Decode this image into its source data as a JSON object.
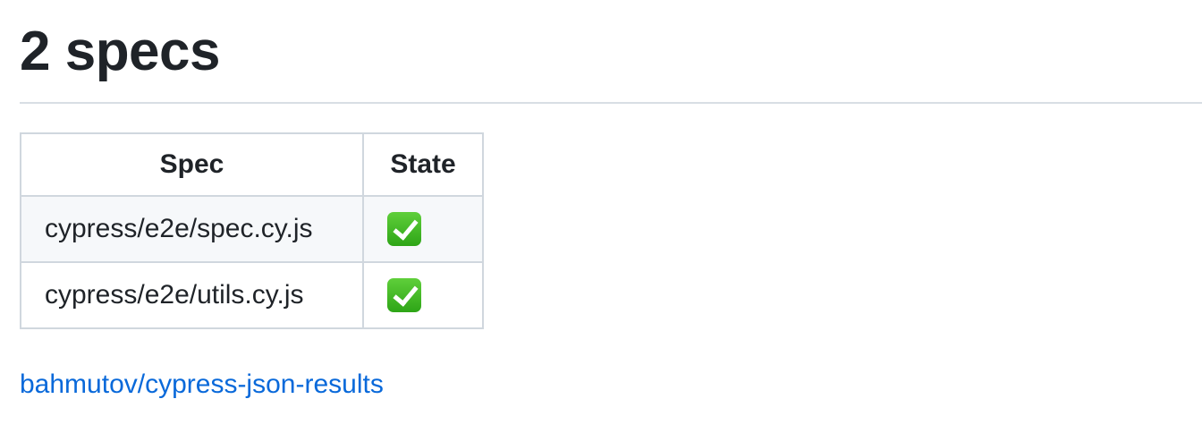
{
  "header": {
    "title": "2 specs"
  },
  "table": {
    "columns": [
      "Spec",
      "State"
    ],
    "rows": [
      {
        "spec": "cypress/e2e/spec.cy.js",
        "state": "passed",
        "state_icon": "check-mark-icon"
      },
      {
        "spec": "cypress/e2e/utils.cy.js",
        "state": "passed",
        "state_icon": "check-mark-icon"
      }
    ]
  },
  "footer": {
    "link_text": "bahmutov/cypress-json-results"
  },
  "colors": {
    "link": "#0969da",
    "success": "#2ea517",
    "border": "#d0d7de"
  }
}
